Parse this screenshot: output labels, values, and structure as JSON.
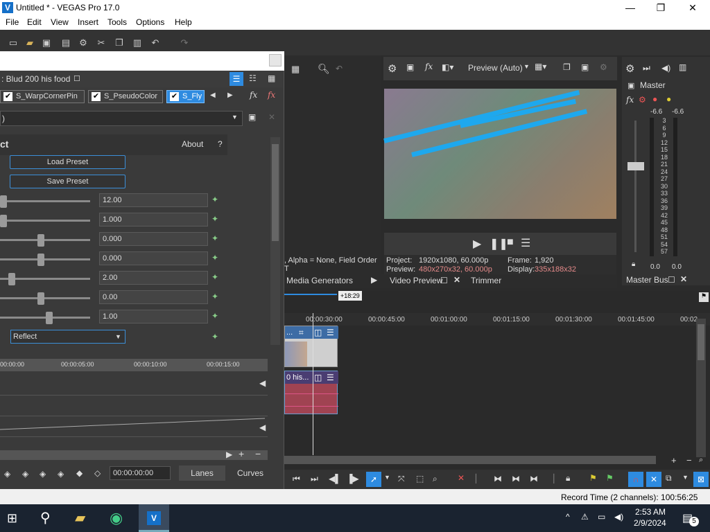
{
  "window": {
    "title": "Untitled * - VEGAS Pro 17.0",
    "minimize": "—",
    "maximize": "❐",
    "close": "✕"
  },
  "menu": [
    "File",
    "Edit",
    "View",
    "Insert",
    "Tools",
    "Options",
    "Help"
  ],
  "plugin": {
    "chain_label": ": Blud 200 his food",
    "chips": [
      "S_WarpCornerPin",
      "S_PseudoColor",
      "S_Fly"
    ],
    "effect_title": "ct",
    "about": "About",
    "help": "?",
    "load_preset": "Load Preset",
    "save_preset": "Save Preset",
    "preset_value": ")",
    "params": [
      {
        "value": "12.00",
        "level": 0.0
      },
      {
        "value": "1.000",
        "level": 0.0
      },
      {
        "value": "0.000",
        "level": 0.45
      },
      {
        "value": "0.000",
        "level": 0.45
      },
      {
        "value": "2.00",
        "level": 0.1
      },
      {
        "value": "0.00",
        "level": 0.45
      },
      {
        "value": "1.00",
        "level": 0.55
      }
    ],
    "dropdown_value": "Reflect",
    "mini_ruler": [
      "00:00:00",
      "00:00:05:00",
      "00:00:10:00",
      "00:00:15:00"
    ],
    "timecode": "00:00:00:00",
    "lanes": "Lanes",
    "curves": "Curves"
  },
  "trimmer_info": ", Alpha = None, Field Order T",
  "preview": {
    "mode": "Preview (Auto)",
    "project_label": "Project:",
    "project": "1920x1080, 60.000p",
    "preview_label": "Preview:",
    "preview": "480x270x32, 60.000p",
    "frame_label": "Frame:",
    "frame": "1,920",
    "display_label": "Display:",
    "display": "335x188x32"
  },
  "tabs": {
    "media_generators": "Media Generators",
    "video_preview": "Video Preview",
    "trimmer": "Trimmer",
    "master_bus": "Master Bus"
  },
  "master": {
    "label": "Master",
    "left_peak": "-6.6",
    "right_peak": "-6.6",
    "scale": [
      "3",
      "6",
      "9",
      "12",
      "15",
      "18",
      "21",
      "24",
      "27",
      "30",
      "33",
      "36",
      "39",
      "42",
      "45",
      "48",
      "51",
      "54",
      "57"
    ],
    "left_level": "0.0",
    "right_level": "0.0"
  },
  "timeline": {
    "offset": "+18:29",
    "ruler": [
      "00:00:30:00",
      "00:00:45:00",
      "00:01:00:00",
      "00:01:15:00",
      "00:01:30:00",
      "00:01:45:00",
      "00:02"
    ],
    "video_clip": "...",
    "audio_clip": "0 his..."
  },
  "status": {
    "record_time": "Record Time (2 channels): 100:56:25"
  },
  "taskbar": {
    "time": "2:53 AM",
    "date": "2/9/2024",
    "notif": "5"
  }
}
